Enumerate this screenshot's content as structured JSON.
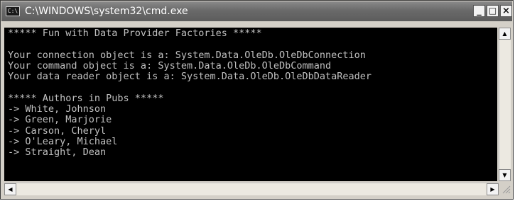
{
  "window": {
    "title": "C:\\WINDOWS\\system32\\cmd.exe",
    "app_icon_text": "C:\\",
    "controls": {
      "minimize": "_",
      "maximize": "□",
      "close": "×"
    }
  },
  "console": {
    "lines": [
      "***** Fun with Data Provider Factories *****",
      "",
      "Your connection object is a: System.Data.OleDb.OleDbConnection",
      "Your command object is a: System.Data.OleDb.OleDbCommand",
      "Your data reader object is a: System.Data.OleDb.OleDbDataReader",
      "",
      "***** Authors in Pubs *****",
      "-> White, Johnson",
      "-> Green, Marjorie",
      "-> Carson, Cheryl",
      "-> O'Leary, Michael",
      "-> Straight, Dean"
    ]
  },
  "scrollbars": {
    "up_arrow": "▲",
    "down_arrow": "▼",
    "left_arrow": "◀",
    "right_arrow": "▶"
  }
}
